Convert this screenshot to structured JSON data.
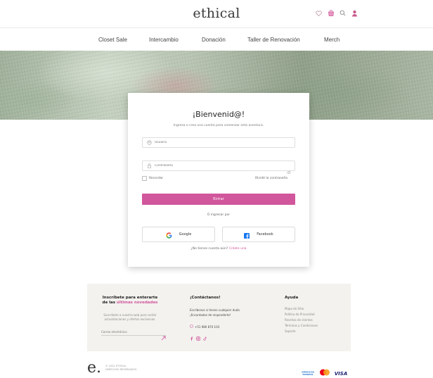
{
  "header": {
    "logo": "ethical",
    "icons": [
      "heart-icon",
      "cart-icon",
      "search-icon",
      "user-icon"
    ]
  },
  "nav": {
    "items": [
      "Closet Sale",
      "Intercambio",
      "Donación",
      "Taller de Renovación",
      "Merch"
    ]
  },
  "login": {
    "title": "¡Bienvenid@!",
    "subtitle": "Ingresa o crea una cuenta para comenzar esta aventura.",
    "username_placeholder": "Usuario",
    "password_placeholder": "Contraseña",
    "remember_label": "Recordar",
    "forgot_label": "Olvidé la contraseña",
    "enter_label": "Entrar",
    "or_login_label": "O ingresar por",
    "google_label": "Google",
    "facebook_label": "Facebook",
    "no_account_text": "¿No tienes cuenta aún?",
    "create_link": "Créate una",
    "colors": {
      "accent": "#d1579c"
    }
  },
  "footer": {
    "subscribe_title_1": "Inscríbete para enterarte",
    "subscribe_title_2": "de las",
    "subscribe_title_pink": "últimas novedades",
    "subscribe_text": "Suscríbete a nuestra web para recibir actualizaciones y ofertas exclusivas.",
    "email_placeholder": "Correo electrónico",
    "contact_title": "¡Contáctanos!",
    "contact_text_1": "Escríbenos si tienes cualquier duda",
    "contact_text_2": "¡Encantados de responderte!",
    "phone": "+51 980 870 103",
    "help_title": "Ayuda",
    "help_links": [
      "Mapa de Sitio",
      "Política de Privacidad",
      "Reseñas de clientes",
      "Términos y Condiciones",
      "Soporte"
    ],
    "bottom_logo": "e.",
    "copyright_1": "© 2022 ETHICAL.",
    "copyright_2": "DERECHOS RESERVADOS.",
    "payments": [
      "AMERICAN EXPRESS",
      "mastercard",
      "VISA"
    ]
  }
}
